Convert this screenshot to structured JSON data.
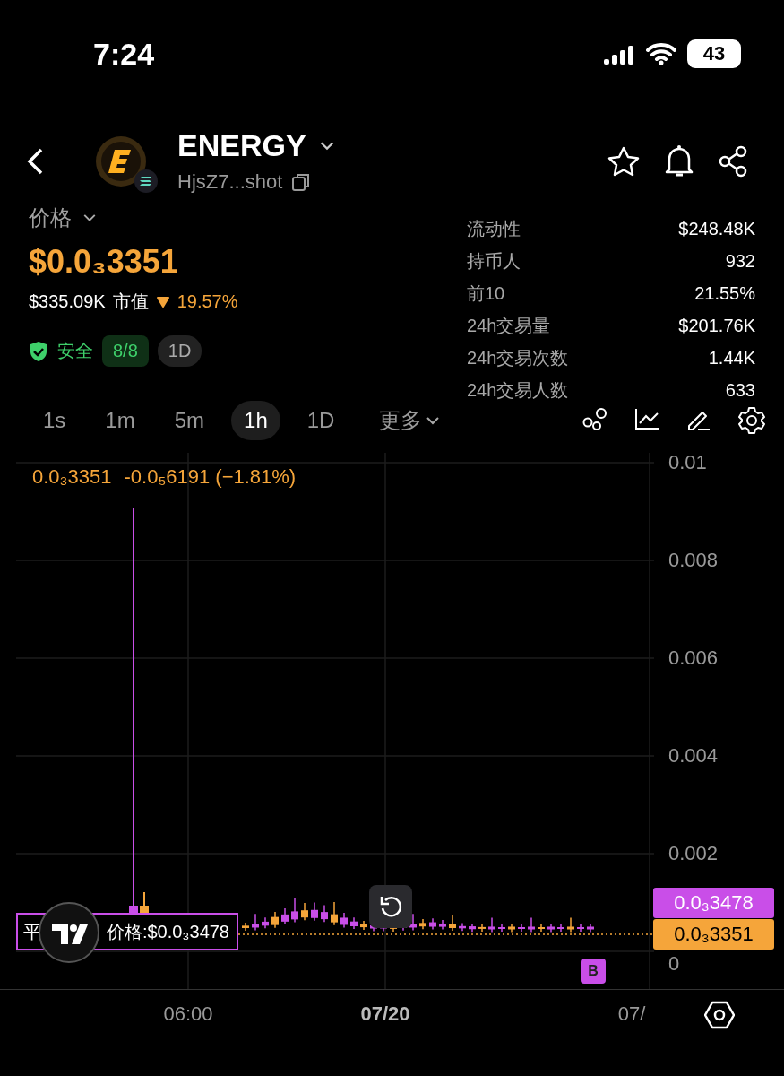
{
  "status_bar": {
    "time": "7:24",
    "battery": "43"
  },
  "header": {
    "title": "ENERGY",
    "address": "HjsZ7...shot"
  },
  "price": {
    "label": "价格",
    "value": "$0.0₃3351",
    "market_cap": "$335.09K",
    "market_cap_label": "市值",
    "change": "19.57%",
    "falling": true,
    "safety_label": "安全",
    "safety_score": "8/8",
    "period": "1D"
  },
  "stats": [
    {
      "label": "流动性",
      "value": "$248.48K"
    },
    {
      "label": "持币人",
      "value": "932"
    },
    {
      "label": "前10",
      "value": "21.55%"
    },
    {
      "label": "24h交易量",
      "value": "$201.76K"
    },
    {
      "label": "24h交易次数",
      "value": "1.44K"
    },
    {
      "label": "24h交易人数",
      "value": "633"
    }
  ],
  "timeframes": [
    {
      "label": "1s",
      "selected": false
    },
    {
      "label": "1m",
      "selected": false
    },
    {
      "label": "5m",
      "selected": false
    },
    {
      "label": "1h",
      "selected": true
    },
    {
      "label": "1D",
      "selected": false
    }
  ],
  "more_menu": "更多",
  "chart": {
    "legend_price": "0.0₃3351",
    "legend_change": "-0.0₅6191 (−1.81%)",
    "y_labels": [
      "0.01",
      "0.008",
      "0.006",
      "0.004",
      "0.002",
      "0"
    ],
    "x_labels": [
      {
        "label": "06:00",
        "bold": false
      },
      {
        "label": "07/20",
        "bold": true
      },
      {
        "label": "07/",
        "bold": false
      }
    ],
    "tooltip_parts": [
      "平",
      "价格:$0.0₃3478"
    ],
    "avg_price_tag": "0.0₃3478",
    "last_price_tag": "0.0₃3351",
    "marker": "B"
  }
}
